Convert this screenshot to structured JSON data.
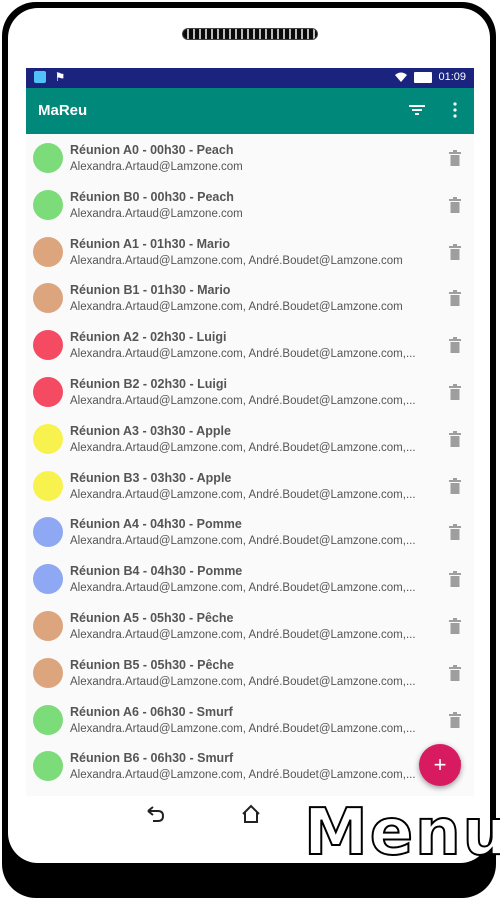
{
  "status": {
    "time": "01:09"
  },
  "app": {
    "title": "MaReu"
  },
  "items": [
    {
      "title": "Réunion A0 - 00h30 - Peach",
      "subtitle": "Alexandra.Artaud@Lamzone.com",
      "color": "#7ddc7a"
    },
    {
      "title": "Réunion B0 - 00h30 - Peach",
      "subtitle": "Alexandra.Artaud@Lamzone.com",
      "color": "#7ddc7a"
    },
    {
      "title": "Réunion A1 - 01h30 - Mario",
      "subtitle": "Alexandra.Artaud@Lamzone.com, André.Boudet@Lamzone.com",
      "color": "#dca57d"
    },
    {
      "title": "Réunion B1 - 01h30 - Mario",
      "subtitle": "Alexandra.Artaud@Lamzone.com, André.Boudet@Lamzone.com",
      "color": "#dca57d"
    },
    {
      "title": "Réunion A2 - 02h30 - Luigi",
      "subtitle": "Alexandra.Artaud@Lamzone.com, André.Boudet@Lamzone.com,...",
      "color": "#f44a62"
    },
    {
      "title": "Réunion B2 - 02h30 - Luigi",
      "subtitle": "Alexandra.Artaud@Lamzone.com, André.Boudet@Lamzone.com,...",
      "color": "#f44a62"
    },
    {
      "title": "Réunion A3 - 03h30 - Apple",
      "subtitle": "Alexandra.Artaud@Lamzone.com, André.Boudet@Lamzone.com,...",
      "color": "#f8f24f"
    },
    {
      "title": "Réunion B3 - 03h30 - Apple",
      "subtitle": "Alexandra.Artaud@Lamzone.com, André.Boudet@Lamzone.com,...",
      "color": "#f8f24f"
    },
    {
      "title": "Réunion A4 - 04h30 - Pomme",
      "subtitle": "Alexandra.Artaud@Lamzone.com, André.Boudet@Lamzone.com,...",
      "color": "#8fa8f4"
    },
    {
      "title": "Réunion B4 - 04h30 - Pomme",
      "subtitle": "Alexandra.Artaud@Lamzone.com, André.Boudet@Lamzone.com,...",
      "color": "#8fa8f4"
    },
    {
      "title": "Réunion A5 - 05h30 - Pêche",
      "subtitle": "Alexandra.Artaud@Lamzone.com, André.Boudet@Lamzone.com,...",
      "color": "#dca57d"
    },
    {
      "title": "Réunion B5 - 05h30 - Pêche",
      "subtitle": "Alexandra.Artaud@Lamzone.com, André.Boudet@Lamzone.com,...",
      "color": "#dca57d"
    },
    {
      "title": "Réunion A6 - 06h30 - Smurf",
      "subtitle": "Alexandra.Artaud@Lamzone.com, André.Boudet@Lamzone.com,...",
      "color": "#7ddc7a"
    },
    {
      "title": "Réunion B6 - 06h30 - Smurf",
      "subtitle": "Alexandra.Artaud@Lamzone.com, André.Boudet@Lamzone.com,...",
      "color": "#7ddc7a"
    }
  ],
  "fab": {
    "label": "+"
  },
  "watermark": {
    "text": "Menu"
  },
  "icons": {
    "filter": "filter-icon",
    "more": "more-vert-icon",
    "trash": "trash-icon",
    "back": "back-icon",
    "home": "home-icon"
  },
  "colors": {
    "status_bar": "#1a237e",
    "app_bar": "#00897b",
    "fab": "#d81b60"
  }
}
